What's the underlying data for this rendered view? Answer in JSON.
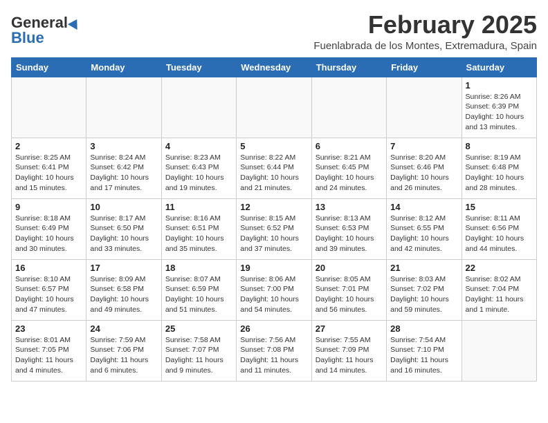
{
  "logo": {
    "general": "General",
    "blue": "Blue"
  },
  "title": "February 2025",
  "location": "Fuenlabrada de los Montes, Extremadura, Spain",
  "weekdays": [
    "Sunday",
    "Monday",
    "Tuesday",
    "Wednesday",
    "Thursday",
    "Friday",
    "Saturday"
  ],
  "weeks": [
    [
      {
        "day": "",
        "info": ""
      },
      {
        "day": "",
        "info": ""
      },
      {
        "day": "",
        "info": ""
      },
      {
        "day": "",
        "info": ""
      },
      {
        "day": "",
        "info": ""
      },
      {
        "day": "",
        "info": ""
      },
      {
        "day": "1",
        "info": "Sunrise: 8:26 AM\nSunset: 6:39 PM\nDaylight: 10 hours\nand 13 minutes."
      }
    ],
    [
      {
        "day": "2",
        "info": "Sunrise: 8:25 AM\nSunset: 6:41 PM\nDaylight: 10 hours\nand 15 minutes."
      },
      {
        "day": "3",
        "info": "Sunrise: 8:24 AM\nSunset: 6:42 PM\nDaylight: 10 hours\nand 17 minutes."
      },
      {
        "day": "4",
        "info": "Sunrise: 8:23 AM\nSunset: 6:43 PM\nDaylight: 10 hours\nand 19 minutes."
      },
      {
        "day": "5",
        "info": "Sunrise: 8:22 AM\nSunset: 6:44 PM\nDaylight: 10 hours\nand 21 minutes."
      },
      {
        "day": "6",
        "info": "Sunrise: 8:21 AM\nSunset: 6:45 PM\nDaylight: 10 hours\nand 24 minutes."
      },
      {
        "day": "7",
        "info": "Sunrise: 8:20 AM\nSunset: 6:46 PM\nDaylight: 10 hours\nand 26 minutes."
      },
      {
        "day": "8",
        "info": "Sunrise: 8:19 AM\nSunset: 6:48 PM\nDaylight: 10 hours\nand 28 minutes."
      }
    ],
    [
      {
        "day": "9",
        "info": "Sunrise: 8:18 AM\nSunset: 6:49 PM\nDaylight: 10 hours\nand 30 minutes."
      },
      {
        "day": "10",
        "info": "Sunrise: 8:17 AM\nSunset: 6:50 PM\nDaylight: 10 hours\nand 33 minutes."
      },
      {
        "day": "11",
        "info": "Sunrise: 8:16 AM\nSunset: 6:51 PM\nDaylight: 10 hours\nand 35 minutes."
      },
      {
        "day": "12",
        "info": "Sunrise: 8:15 AM\nSunset: 6:52 PM\nDaylight: 10 hours\nand 37 minutes."
      },
      {
        "day": "13",
        "info": "Sunrise: 8:13 AM\nSunset: 6:53 PM\nDaylight: 10 hours\nand 39 minutes."
      },
      {
        "day": "14",
        "info": "Sunrise: 8:12 AM\nSunset: 6:55 PM\nDaylight: 10 hours\nand 42 minutes."
      },
      {
        "day": "15",
        "info": "Sunrise: 8:11 AM\nSunset: 6:56 PM\nDaylight: 10 hours\nand 44 minutes."
      }
    ],
    [
      {
        "day": "16",
        "info": "Sunrise: 8:10 AM\nSunset: 6:57 PM\nDaylight: 10 hours\nand 47 minutes."
      },
      {
        "day": "17",
        "info": "Sunrise: 8:09 AM\nSunset: 6:58 PM\nDaylight: 10 hours\nand 49 minutes."
      },
      {
        "day": "18",
        "info": "Sunrise: 8:07 AM\nSunset: 6:59 PM\nDaylight: 10 hours\nand 51 minutes."
      },
      {
        "day": "19",
        "info": "Sunrise: 8:06 AM\nSunset: 7:00 PM\nDaylight: 10 hours\nand 54 minutes."
      },
      {
        "day": "20",
        "info": "Sunrise: 8:05 AM\nSunset: 7:01 PM\nDaylight: 10 hours\nand 56 minutes."
      },
      {
        "day": "21",
        "info": "Sunrise: 8:03 AM\nSunset: 7:02 PM\nDaylight: 10 hours\nand 59 minutes."
      },
      {
        "day": "22",
        "info": "Sunrise: 8:02 AM\nSunset: 7:04 PM\nDaylight: 11 hours\nand 1 minute."
      }
    ],
    [
      {
        "day": "23",
        "info": "Sunrise: 8:01 AM\nSunset: 7:05 PM\nDaylight: 11 hours\nand 4 minutes."
      },
      {
        "day": "24",
        "info": "Sunrise: 7:59 AM\nSunset: 7:06 PM\nDaylight: 11 hours\nand 6 minutes."
      },
      {
        "day": "25",
        "info": "Sunrise: 7:58 AM\nSunset: 7:07 PM\nDaylight: 11 hours\nand 9 minutes."
      },
      {
        "day": "26",
        "info": "Sunrise: 7:56 AM\nSunset: 7:08 PM\nDaylight: 11 hours\nand 11 minutes."
      },
      {
        "day": "27",
        "info": "Sunrise: 7:55 AM\nSunset: 7:09 PM\nDaylight: 11 hours\nand 14 minutes."
      },
      {
        "day": "28",
        "info": "Sunrise: 7:54 AM\nSunset: 7:10 PM\nDaylight: 11 hours\nand 16 minutes."
      },
      {
        "day": "",
        "info": ""
      }
    ]
  ]
}
